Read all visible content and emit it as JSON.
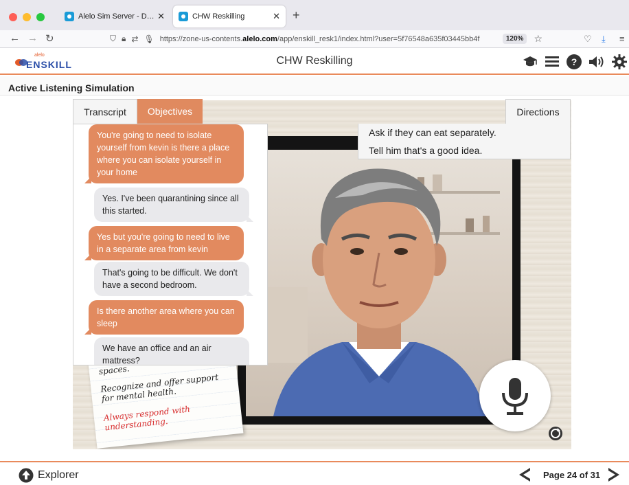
{
  "browser": {
    "tabs": [
      {
        "title": "Alelo Sim Server - Dashboard Li",
        "active": false
      },
      {
        "title": "CHW Reskilling",
        "active": true
      }
    ],
    "url_prefix": "https://zone-us-contents.",
    "url_domain": "alelo.com",
    "url_rest": "/app/enskill_resk1/index.html?user=5f76548a635f03445bb4f",
    "zoom": "120%"
  },
  "app": {
    "logo_small": "alelo",
    "logo_main": "ENSKILL",
    "title": "CHW Reskilling",
    "header_icons": [
      "graduation-cap-icon",
      "list-icon",
      "help-icon",
      "volume-icon",
      "gear-icon"
    ],
    "accent_color": "#e98a5b"
  },
  "simulation": {
    "title": "Active Listening Simulation",
    "tabs": {
      "transcript": "Transcript",
      "objectives": "Objectives",
      "directions": "Directions"
    },
    "transcript": [
      {
        "speaker": "user",
        "text": "You're going to need to isolate yourself from kevin is there a place where you can isolate yourself in your home"
      },
      {
        "speaker": "npc",
        "text": "Yes. I've been quarantining since all this started."
      },
      {
        "speaker": "user",
        "text": "Yes but you're going to need to live in a separate area from kevin"
      },
      {
        "speaker": "npc",
        "text": "That's going to be difficult. We don't have a second bedroom."
      },
      {
        "speaker": "user",
        "text": "Is there another area where you can sleep"
      },
      {
        "speaker": "npc",
        "text": "We have an office and an air mattress?"
      }
    ],
    "directions": [
      "Ask if they can eat separately.",
      "Tell him that's a good idea."
    ],
    "note": [
      {
        "text": "Address issues with shared spaces.",
        "style": "normal"
      },
      {
        "text": "Recognize and offer support for mental health.",
        "style": "normal"
      },
      {
        "text": "Always respond with understanding.",
        "style": "red"
      }
    ]
  },
  "footer": {
    "explorer_label": "Explorer",
    "page_label": "Page 24 of 31"
  }
}
